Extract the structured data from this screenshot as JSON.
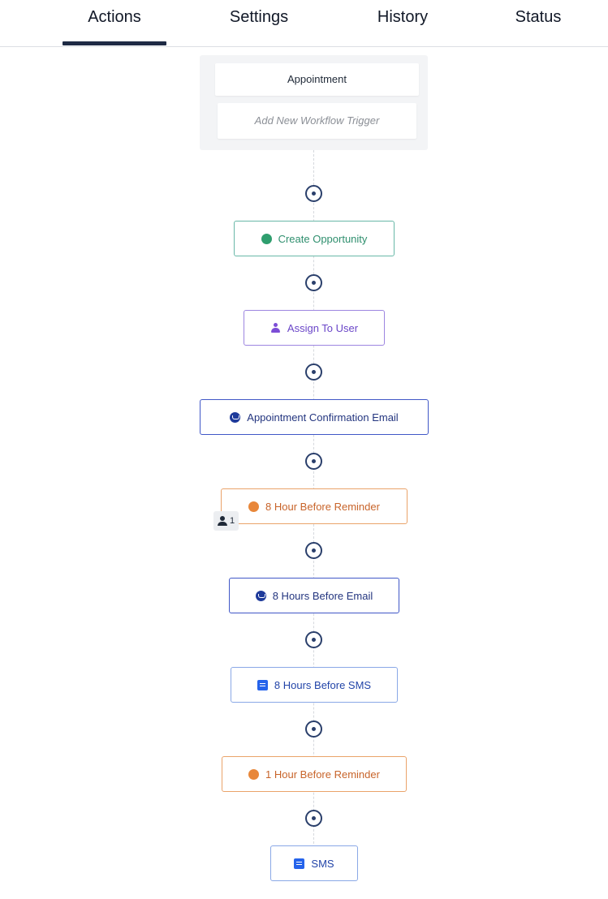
{
  "tabs": {
    "actions": "Actions",
    "settings": "Settings",
    "history": "History",
    "status": "Status"
  },
  "trigger": {
    "main": "Appointment",
    "add": "Add New Workflow Trigger"
  },
  "actions": [
    {
      "label": "Create Opportunity",
      "icon": "opportunity-icon",
      "color": "#2f8f6e"
    },
    {
      "label": "Assign To User",
      "icon": "user-assign-icon",
      "color": "#7c4dd6"
    },
    {
      "label": "Appointment Confirmation Email",
      "icon": "email-icon",
      "color": "#1e40af"
    },
    {
      "label": "8 Hour Before Reminder",
      "icon": "reminder-icon",
      "color": "#e8873a"
    },
    {
      "label": "8 Hours Before Email",
      "icon": "email-icon",
      "color": "#1e40af"
    },
    {
      "label": "8 Hours Before SMS",
      "icon": "sms-icon",
      "color": "#2563eb"
    },
    {
      "label": "1 Hour Before Reminder",
      "icon": "reminder-icon",
      "color": "#e8873a"
    },
    {
      "label": "SMS",
      "icon": "sms-icon",
      "color": "#2563eb"
    }
  ],
  "badge": {
    "count": "1",
    "icon": "person-icon"
  }
}
